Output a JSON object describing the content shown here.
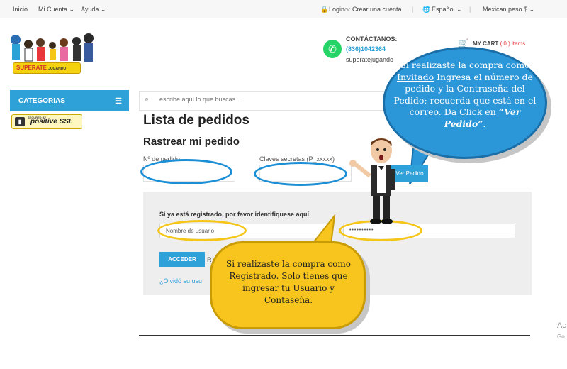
{
  "topbar": {
    "inicio": "Inicio",
    "mi_cuenta": "Mi Cuenta",
    "ayuda": "Ayuda",
    "login": "Login",
    "or": "or",
    "crear_cuenta": "Crear una cuenta",
    "idioma": "Español",
    "moneda": "Mexican peso $",
    "chevron": "⌄"
  },
  "logo": {
    "text": "SUPERATE",
    "subtext": "JUGANDO"
  },
  "contact": {
    "title": "CONTÁCTANOS:",
    "phone": "(836)1042364",
    "email": "superatejugando"
  },
  "cart": {
    "label": "MY CART",
    "count": "( 0 ) items"
  },
  "sidebar": {
    "categories_label": "CATEGORIAS",
    "menu_icon": "☰",
    "ssl_top": "SECURED BY",
    "ssl_label": "positive SSL"
  },
  "search": {
    "placeholder": "escribe aquí lo que buscas.."
  },
  "main": {
    "title": "Lista de pedidos",
    "subtitle": "Rastrear mi pedido",
    "order_label": "Nº de pedido",
    "password_label": "Claves secretas (P_xxxxx)",
    "ver_pedido": "Ver Pedido"
  },
  "login": {
    "title": "Si ya está registrado, por favor identifiquese aquí",
    "username_placeholder": "Nombre de usuario",
    "password_value": "••••••••••",
    "button": "ACCEDER",
    "r_text": "R",
    "forgot": "¿Olvidó su usu"
  },
  "ghost": {
    "line1": "Ac",
    "line2": "Go"
  },
  "bubble_blue": {
    "p1": "Si realizaste la compra como",
    "invitado": "Invitado",
    "p2": "Ingresa el número de pedido y la Contraseña del Pedido; recuerda que está en el correo.  Da Click en",
    "ver_pedido": "“Ver Pedido”",
    "p3": "."
  },
  "bubble_yellow": {
    "p1": "Si realizaste la compra como",
    "registrado": "Registrado.",
    "p2": "Solo tienes que ingresar tu Usuario y Contaseña."
  },
  "icons": {
    "search": "🔍",
    "cart": "🛒",
    "whatsapp": "✆",
    "lock": "🔒",
    "globe": "🌐",
    "chevron": "⌄"
  },
  "colors": {
    "accent": "#2ea1d9",
    "bubble_blue": "#2b96d8",
    "bubble_yellow": "#f7c51d",
    "highlight_ellipse_blue": "#1b8fd6",
    "highlight_ellipse_yellow": "#f5c518"
  }
}
